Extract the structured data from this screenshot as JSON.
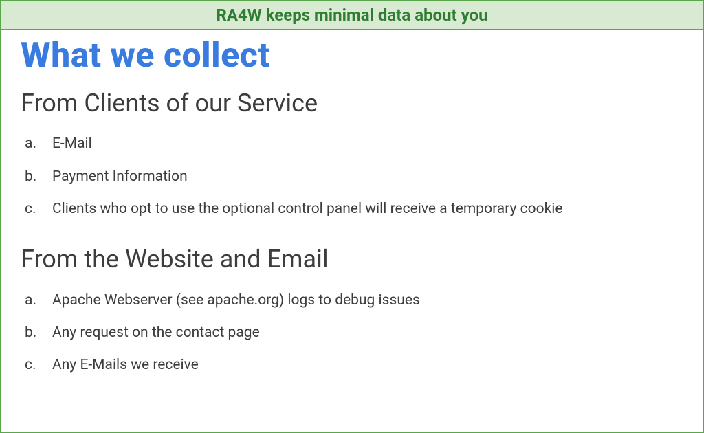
{
  "banner": {
    "text": "RA4W keeps minimal data about you"
  },
  "page": {
    "title": "What we collect"
  },
  "sections": [
    {
      "heading": "From Clients of our Service",
      "items": [
        "E-Mail",
        "Payment Information",
        "Clients who opt to use the optional control panel will receive a temporary cookie"
      ]
    },
    {
      "heading": "From the Website and Email",
      "items": [
        "Apache Webserver (see apache.org) logs to debug issues",
        "Any request on the contact page",
        "Any E-Mails we receive"
      ]
    }
  ],
  "colors": {
    "accent_green": "#5aa64a",
    "banner_bg": "#d9ead3",
    "banner_text": "#2e7d32",
    "title_blue": "#3a7be0",
    "body_text": "#3d3d3d"
  }
}
